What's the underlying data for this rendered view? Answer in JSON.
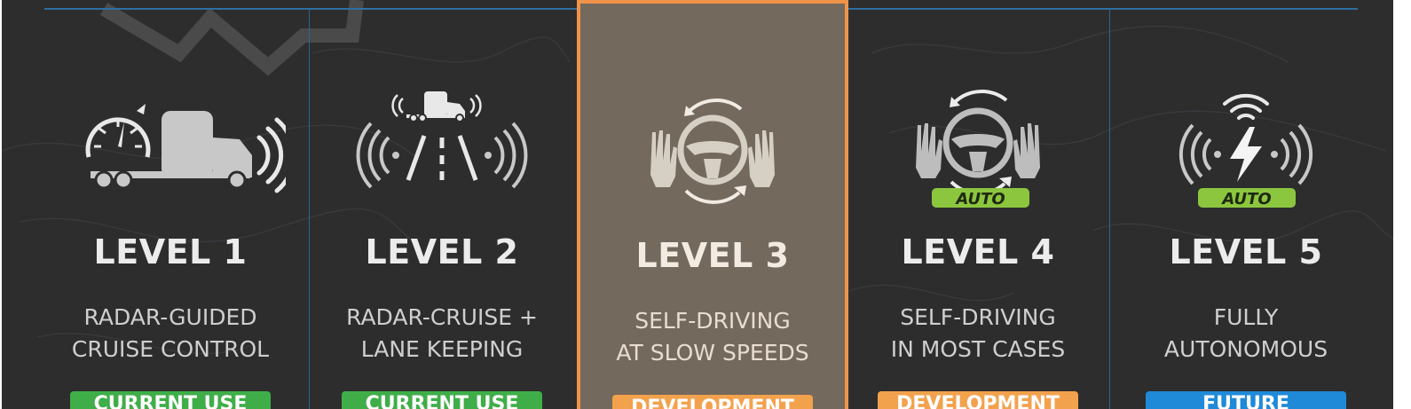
{
  "cards": [
    {
      "level": "LEVEL 1",
      "desc1": "RADAR-GUIDED",
      "desc2": "CRUISE CONTROL",
      "status": "CURRENT USE",
      "status_color": "#3fae49"
    },
    {
      "level": "LEVEL 2",
      "desc1": "RADAR-CRUISE +",
      "desc2": "LANE KEEPING",
      "status": "CURRENT USE",
      "status_color": "#3fae49"
    },
    {
      "level": "LEVEL 3",
      "desc1": "SELF-DRIVING",
      "desc2": "AT SLOW SPEEDS",
      "status": "DEVELOPMENT",
      "status_color": "#f2a24d"
    },
    {
      "level": "LEVEL 4",
      "desc1": "SELF-DRIVING",
      "desc2": "IN MOST CASES",
      "status": "DEVELOPMENT",
      "status_color": "#f2a24d"
    },
    {
      "level": "LEVEL 5",
      "desc1": "FULLY",
      "desc2": "AUTONOMOUS",
      "status": "FUTURE",
      "status_color": "#1f8ad8"
    }
  ],
  "auto_label": "AUTO",
  "colors": {
    "background": "#2d2d2d",
    "highlight": "#74695d",
    "highlight_border": "#f0934a",
    "icon_gray": "#c8c8c8",
    "auto_green": "#8cc63f",
    "divider_blue": "#2b6796"
  },
  "icons": [
    "speedometer-truck-radar-icon",
    "truck-lane-radar-icon",
    "hands-steering-wheel-icon",
    "hands-steering-wheel-auto-icon",
    "wifi-lightning-auto-icon"
  ]
}
